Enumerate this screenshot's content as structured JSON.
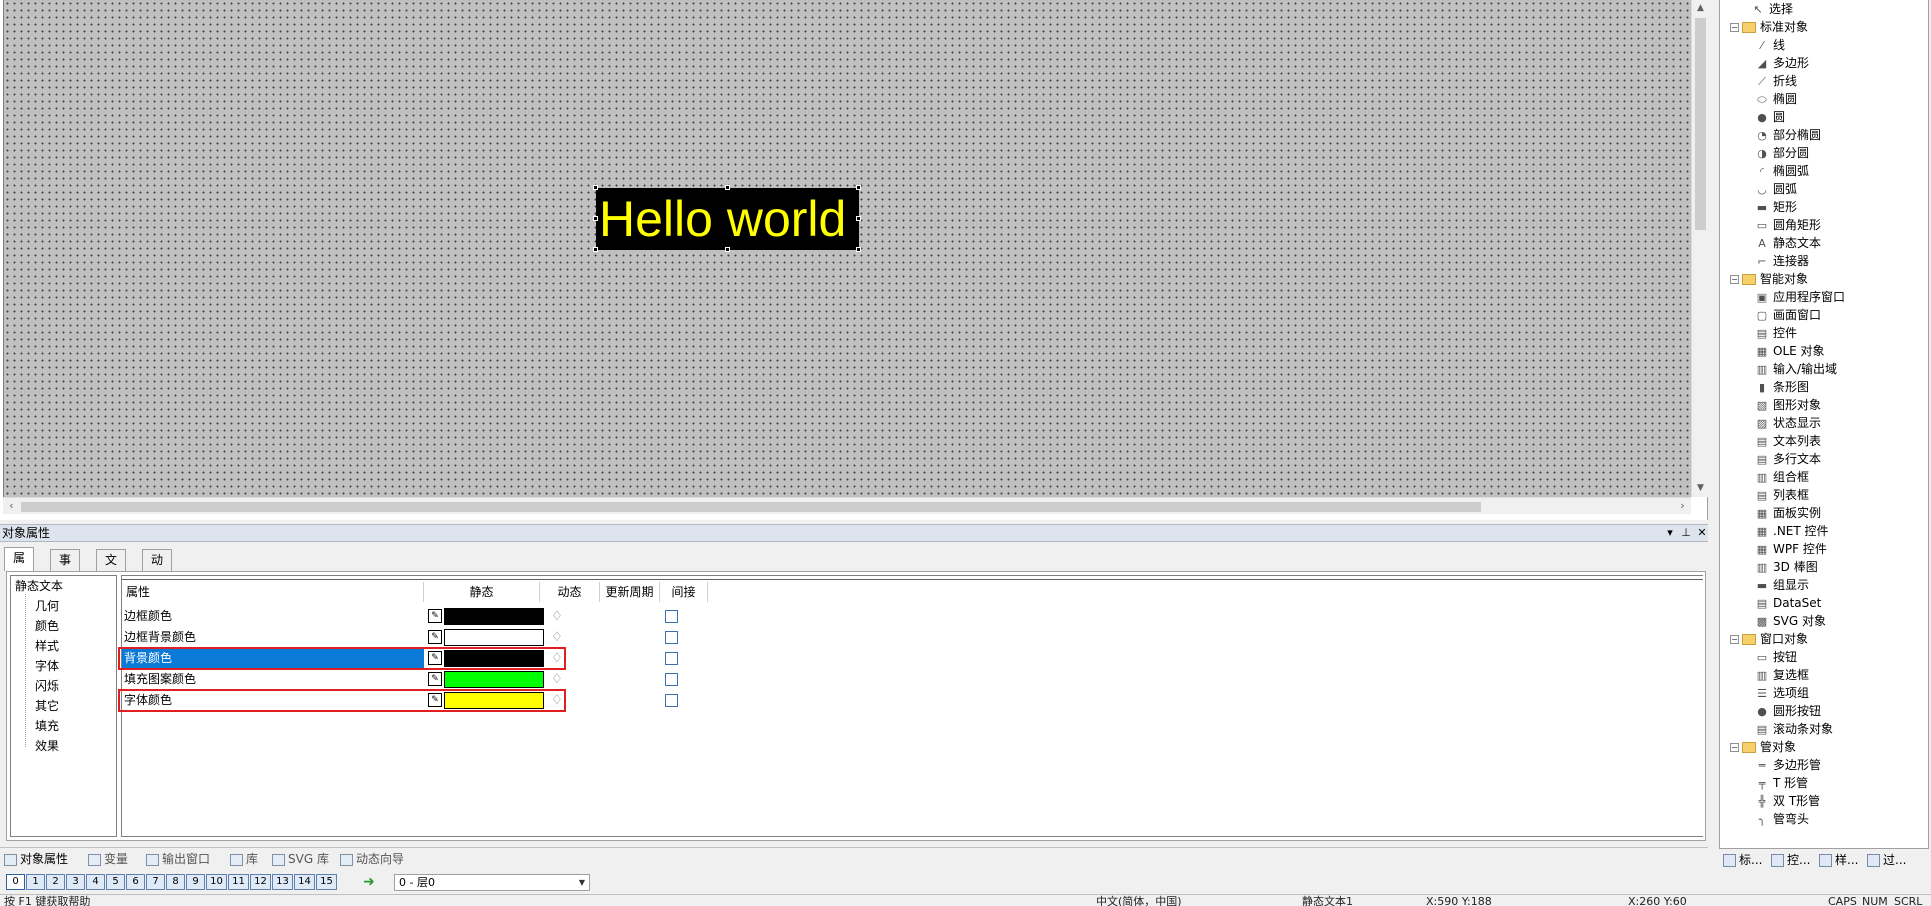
{
  "canvas": {
    "object_text": "Hello world",
    "object_bg": "#000000",
    "object_fg": "#ffff00"
  },
  "toolbox": {
    "items": [
      {
        "label": "选择",
        "level": 0,
        "icon": "cursor-icon"
      },
      {
        "label": "标准对象",
        "level": 0,
        "group": true
      },
      {
        "label": "线",
        "level": 1,
        "icon": "line-icon"
      },
      {
        "label": "多边形",
        "level": 1,
        "icon": "polygon-icon"
      },
      {
        "label": "折线",
        "level": 1,
        "icon": "polyline-icon"
      },
      {
        "label": "椭圆",
        "level": 1,
        "icon": "ellipse-icon"
      },
      {
        "label": "圆",
        "level": 1,
        "icon": "circle-icon"
      },
      {
        "label": "部分椭圆",
        "level": 1,
        "icon": "ellipse-segment-icon"
      },
      {
        "label": "部分圆",
        "level": 1,
        "icon": "circle-segment-icon"
      },
      {
        "label": "椭圆弧",
        "level": 1,
        "icon": "ellipse-arc-icon"
      },
      {
        "label": "圆弧",
        "level": 1,
        "icon": "circle-arc-icon"
      },
      {
        "label": "矩形",
        "level": 1,
        "icon": "rectangle-icon"
      },
      {
        "label": "圆角矩形",
        "level": 1,
        "icon": "rounded-rectangle-icon"
      },
      {
        "label": "静态文本",
        "level": 1,
        "icon": "static-text-icon"
      },
      {
        "label": "连接器",
        "level": 1,
        "icon": "connector-icon"
      },
      {
        "label": "智能对象",
        "level": 0,
        "group": true
      },
      {
        "label": "应用程序窗口",
        "level": 1,
        "icon": "app-window-icon"
      },
      {
        "label": "画面窗口",
        "level": 1,
        "icon": "screen-window-icon"
      },
      {
        "label": "控件",
        "level": 1,
        "icon": "control-icon"
      },
      {
        "label": "OLE 对象",
        "level": 1,
        "icon": "ole-object-icon"
      },
      {
        "label": "输入/输出域",
        "level": 1,
        "icon": "io-field-icon"
      },
      {
        "label": "条形图",
        "level": 1,
        "icon": "bar-graph-icon"
      },
      {
        "label": "图形对象",
        "level": 1,
        "icon": "graphic-object-icon"
      },
      {
        "label": "状态显示",
        "level": 1,
        "icon": "status-display-icon"
      },
      {
        "label": "文本列表",
        "level": 1,
        "icon": "text-list-icon"
      },
      {
        "label": "多行文本",
        "level": 1,
        "icon": "multiline-text-icon"
      },
      {
        "label": "组合框",
        "level": 1,
        "icon": "combobox-icon"
      },
      {
        "label": "列表框",
        "level": 1,
        "icon": "listbox-icon"
      },
      {
        "label": "面板实例",
        "level": 1,
        "icon": "faceplate-icon"
      },
      {
        "label": ".NET 控件",
        "level": 1,
        "icon": "dotnet-control-icon"
      },
      {
        "label": "WPF 控件",
        "level": 1,
        "icon": "wpf-control-icon"
      },
      {
        "label": "3D 棒图",
        "level": 1,
        "icon": "3d-bar-icon"
      },
      {
        "label": "组显示",
        "level": 1,
        "icon": "group-display-icon"
      },
      {
        "label": "DataSet",
        "level": 1,
        "icon": "dataset-icon"
      },
      {
        "label": "SVG 对象",
        "level": 1,
        "icon": "svg-object-icon"
      },
      {
        "label": "窗口对象",
        "level": 0,
        "group": true
      },
      {
        "label": "按钮",
        "level": 1,
        "icon": "button-icon"
      },
      {
        "label": "复选框",
        "level": 1,
        "icon": "checkbox-icon"
      },
      {
        "label": "选项组",
        "level": 1,
        "icon": "option-group-icon"
      },
      {
        "label": "圆形按钮",
        "level": 1,
        "icon": "round-button-icon"
      },
      {
        "label": "滚动条对象",
        "level": 1,
        "icon": "scrollbar-object-icon"
      },
      {
        "label": "管对象",
        "level": 0,
        "group": true
      },
      {
        "label": "多边形管",
        "level": 1,
        "icon": "polygon-tube-icon"
      },
      {
        "label": "T 形管",
        "level": 1,
        "icon": "t-tube-icon"
      },
      {
        "label": "双 T形管",
        "level": 1,
        "icon": "double-t-tube-icon"
      },
      {
        "label": "管弯头",
        "level": 1,
        "icon": "tube-elbow-icon"
      }
    ],
    "tabs": [
      {
        "label": "标...",
        "icon": "standard-tab-icon"
      },
      {
        "label": "控...",
        "icon": "controls-tab-icon"
      },
      {
        "label": "样...",
        "icon": "styles-tab-icon"
      },
      {
        "label": "过...",
        "icon": "filter-tab-icon"
      }
    ]
  },
  "props_panel": {
    "title": "对象属性",
    "tabs": [
      "属性",
      "事件",
      "文本",
      "动画"
    ],
    "categories": [
      "静态文本",
      "几何",
      "颜色",
      "样式",
      "字体",
      "闪烁",
      "其它",
      "填充",
      "效果"
    ],
    "columns": [
      "属性",
      "静态",
      "动态",
      "更新周期",
      "间接"
    ],
    "rows": [
      {
        "name": "边框颜色",
        "color": "#000000",
        "selected": false,
        "highlight": false
      },
      {
        "name": "边框背景颜色",
        "color": "#ffffff",
        "selected": false,
        "highlight": false
      },
      {
        "name": "背景颜色",
        "color": "#000000",
        "selected": true,
        "highlight": true
      },
      {
        "name": "填充图案颜色",
        "color": "#00ff00",
        "selected": false,
        "highlight": false
      },
      {
        "name": "字体颜色",
        "color": "#ffff00",
        "selected": false,
        "highlight": true
      }
    ]
  },
  "bottom_tabs": [
    {
      "label": "对象属性",
      "icon": "properties-icon"
    },
    {
      "label": "变量",
      "icon": "tag-icon"
    },
    {
      "label": "输出窗口",
      "icon": "output-window-icon"
    },
    {
      "label": "库",
      "icon": "library-folder-icon"
    },
    {
      "label": "SVG 库",
      "icon": "svg-library-icon"
    },
    {
      "label": "动态向导",
      "icon": "dynamic-wizard-icon"
    }
  ],
  "layers": {
    "buttons": [
      "0",
      "1",
      "2",
      "3",
      "4",
      "5",
      "6",
      "7",
      "8",
      "9",
      "10",
      "11",
      "12",
      "13",
      "14",
      "15"
    ],
    "active": "0",
    "current": "0 - 层0"
  },
  "status_bar": {
    "help": "按 F1 键获取帮助",
    "language": "中文(简体，中国)",
    "object": "静态文本1",
    "position": "X:590 Y:188",
    "size": "X:260 Y:60",
    "caps": "CAPS",
    "num": "NUM",
    "scrl": "SCRL"
  }
}
